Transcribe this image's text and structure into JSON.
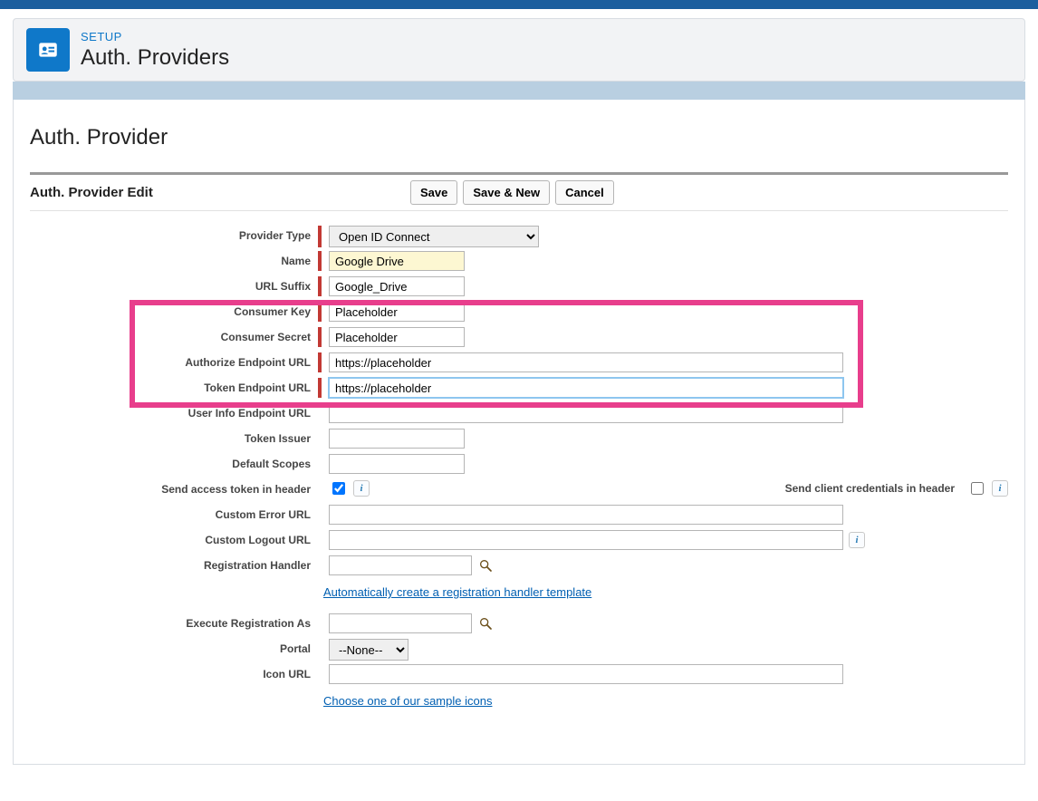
{
  "header": {
    "eyebrow": "SETUP",
    "title": "Auth. Providers"
  },
  "page_title": "Auth. Provider",
  "section_title": "Auth. Provider Edit",
  "buttons": {
    "save": "Save",
    "save_new": "Save & New",
    "cancel": "Cancel"
  },
  "labels": {
    "provider_type": "Provider Type",
    "name": "Name",
    "url_suffix": "URL Suffix",
    "consumer_key": "Consumer Key",
    "consumer_secret": "Consumer Secret",
    "authorize_endpoint": "Authorize Endpoint URL",
    "token_endpoint": "Token Endpoint URL",
    "userinfo_endpoint": "User Info Endpoint URL",
    "token_issuer": "Token Issuer",
    "default_scopes": "Default Scopes",
    "send_token_header": "Send access token in header",
    "send_client_header": "Send client credentials in header",
    "custom_error_url": "Custom Error URL",
    "custom_logout_url": "Custom Logout URL",
    "registration_handler": "Registration Handler",
    "execute_registration_as": "Execute Registration As",
    "portal": "Portal",
    "icon_url": "Icon URL"
  },
  "values": {
    "provider_type": "Open ID Connect",
    "name": "Google Drive",
    "url_suffix": "Google_Drive",
    "consumer_key": "Placeholder",
    "consumer_secret": "Placeholder",
    "authorize_endpoint": "https://placeholder",
    "token_endpoint": "https://placeholder",
    "userinfo_endpoint": "",
    "token_issuer": "",
    "default_scopes": "",
    "send_token_header_checked": true,
    "send_client_header_checked": false,
    "custom_error_url": "",
    "custom_logout_url": "",
    "registration_handler": "",
    "execute_registration_as": "",
    "portal": "--None--",
    "icon_url": ""
  },
  "helpers": {
    "reg_handler_link": "Automatically create a registration handler template",
    "icon_link": "Choose one of our sample icons"
  }
}
